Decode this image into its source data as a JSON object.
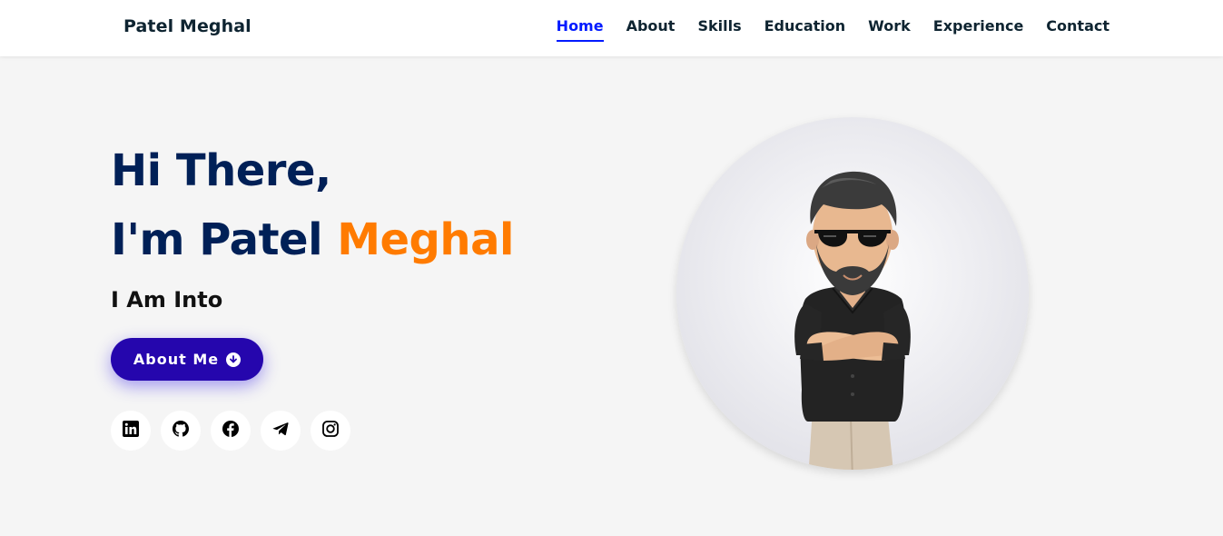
{
  "header": {
    "logo": "Patel Meghal",
    "nav": [
      {
        "label": "Home",
        "active": true
      },
      {
        "label": "About"
      },
      {
        "label": "Skills"
      },
      {
        "label": "Education"
      },
      {
        "label": "Work"
      },
      {
        "label": "Experience"
      },
      {
        "label": "Contact"
      }
    ]
  },
  "hero": {
    "line1": "Hi There,",
    "line2_prefix": "I'm Patel ",
    "line2_accent": "Meghal",
    "subtitle": "I Am Into",
    "button_label": "About Me",
    "button_icon": "arrow-circle-down-icon"
  },
  "socials": [
    {
      "name": "linkedin-icon"
    },
    {
      "name": "github-icon"
    },
    {
      "name": "facebook-icon"
    },
    {
      "name": "telegram-icon"
    },
    {
      "name": "instagram-icon"
    }
  ],
  "colors": {
    "primary_text": "#002057",
    "accent": "#ff7b00",
    "nav_active": "#011aff",
    "button": "#2506ad",
    "background": "#f5f5f5"
  }
}
